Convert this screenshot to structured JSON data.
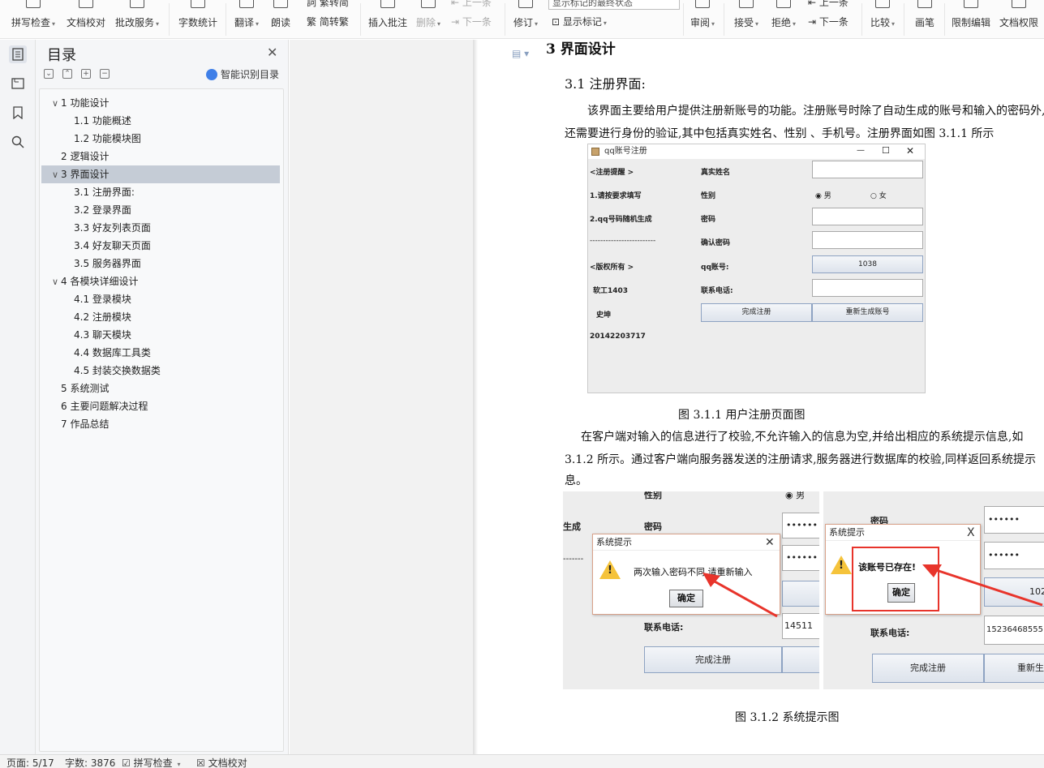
{
  "ribbon": {
    "spell_check": "拼写检查",
    "doc_proof": "文档校对",
    "batch_service": "批改服务",
    "word_count": "字数统计",
    "translate": "翻译",
    "read_aloud": "朗读",
    "trad_simp": "繁转简",
    "simp_trad": "简转繁",
    "insert_comment": "插入批注",
    "delete": "删除",
    "prev": "上一条",
    "next": "下一条",
    "revise": "修订",
    "markup_select": "显示标记的最终状态",
    "show_markup": "显示标记",
    "review": "审阅",
    "accept": "接受",
    "reject": "拒绝",
    "prev2": "上一条",
    "next2": "下一条",
    "compare": "比较",
    "pen": "画笔",
    "restrict_edit": "限制编辑",
    "doc_perm": "文档权限"
  },
  "toc": {
    "title": "目录",
    "smart": "智能识别目录",
    "items": [
      {
        "label": "1  功能设计",
        "level": 1,
        "caret": "∨",
        "selected": false
      },
      {
        "label": "1.1 功能概述",
        "level": 2,
        "caret": "",
        "selected": false
      },
      {
        "label": "1.2 功能模块图",
        "level": 2,
        "caret": "",
        "selected": false
      },
      {
        "label": "2  逻辑设计",
        "level": 1,
        "caret": "",
        "selected": false
      },
      {
        "label": "3  界面设计",
        "level": 1,
        "caret": "∨",
        "selected": true
      },
      {
        "label": "3.1 注册界面:",
        "level": 2,
        "caret": "",
        "selected": false
      },
      {
        "label": "3.2 登录界面",
        "level": 2,
        "caret": "",
        "selected": false
      },
      {
        "label": "3.3 好友列表页面",
        "level": 2,
        "caret": "",
        "selected": false
      },
      {
        "label": "3.4 好友聊天页面",
        "level": 2,
        "caret": "",
        "selected": false
      },
      {
        "label": "3.5 服务器界面",
        "level": 2,
        "caret": "",
        "selected": false
      },
      {
        "label": "4  各模块详细设计",
        "level": 1,
        "caret": "∨",
        "selected": false
      },
      {
        "label": "4.1 登录模块",
        "level": 2,
        "caret": "",
        "selected": false
      },
      {
        "label": "4.2 注册模块",
        "level": 2,
        "caret": "",
        "selected": false
      },
      {
        "label": "4.3 聊天模块",
        "level": 2,
        "caret": "",
        "selected": false
      },
      {
        "label": "4.4 数据库工具类",
        "level": 2,
        "caret": "",
        "selected": false
      },
      {
        "label": "4.5 封装交换数据类",
        "level": 2,
        "caret": "",
        "selected": false
      },
      {
        "label": "5  系统测试",
        "level": 1,
        "caret": "",
        "selected": false
      },
      {
        "label": "6  主要问题解决过程",
        "level": 1,
        "caret": "",
        "selected": false
      },
      {
        "label": "7  作品总结",
        "level": 1,
        "caret": "",
        "selected": false
      }
    ]
  },
  "doc": {
    "partial_heading": "3  界面设计",
    "heading": "3.1 注册界面:",
    "para1_line1": "该界面主要给用户提供注册新账号的功能。注册账号时除了自动生成的账号和输入的密码外,",
    "para1_line2": "还需要进行身份的验证,其中包括真实姓名、性别 、手机号。注册界面如图 3.1.1 所示",
    "fig1_caption": "图 3.1.1  用户注册页面图",
    "para2_line1": "在客户端对输入的信息进行了校验,不允许输入的信息为空,并给出相应的系统提示信息,如",
    "para2_line2": "3.1.2 所示。通过客户端向服务器发送的注册请求,服务器进行数据库的校验,同样返回系统提示",
    "para2_line3": "息。",
    "fig2_caption": "图 3.1.2  系统提示图"
  },
  "fig1": {
    "window_title": "qq账号注册",
    "l1": "<注册提醒  >",
    "l2": "1.请按要求填写",
    "l3": "2.qq号码随机生成",
    "l4": "-------------------------",
    "l5": "<版权所有  >",
    "l6": "软工1403",
    "l7": "史坤",
    "l8": "20142203717",
    "f_name": "真实姓名",
    "f_gender": "性别",
    "male": "男",
    "female": "女",
    "f_pwd": "密码",
    "f_confirm": "确认密码",
    "f_qq": "qq账号:",
    "qq_value": "1038",
    "f_phone": "联系电话:",
    "btn_done": "完成注册",
    "btn_regen": "重新生成账号"
  },
  "fig2": {
    "left": {
      "gender": "性别",
      "male": "男",
      "gen_frag": "生成",
      "pwd": "密码",
      "pwd_mask": "••••••",
      "pwd_mask2": "••••••",
      "dashes": "-------",
      "phone": "联系电话:",
      "phone_val": "14511",
      "btn_done": "完成注册",
      "dlg_title": "系统提示",
      "dlg_msg": "两次输入密码不同,请重新输入",
      "dlg_ok": "确定"
    },
    "right": {
      "pwd": "密码",
      "pwd_mask": "••••••",
      "pwd_mask2": "••••••",
      "qq_frag": "102",
      "phone": "联系电话:",
      "phone_val": "15236468555",
      "btn_done": "完成注册",
      "btn_regen": "重新生成",
      "dlg_title": "系统提示",
      "dlg_msg": "该账号已存在!",
      "dlg_ok": "确定"
    }
  },
  "status": {
    "page": "页面: 5/17",
    "words": "字数: 3876",
    "spell": "拼写检查",
    "proof": "文档校对"
  }
}
